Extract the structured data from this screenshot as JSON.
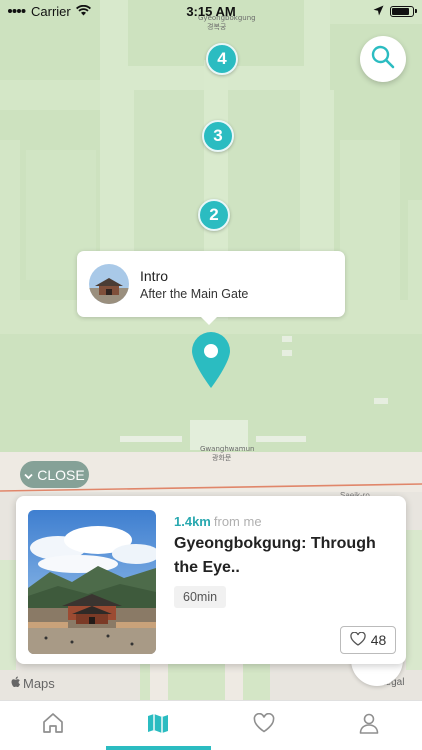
{
  "status_bar": {
    "carrier": "Carrier",
    "time": "3:15 AM",
    "battery_level_percent": 90
  },
  "map": {
    "place_label_en": "Gyeongbokgung",
    "place_label_kr": "경복궁",
    "gate_label_en": "Gwanghwamun",
    "gate_label_kr": "광화문",
    "road_label": "Saejk-ro",
    "maps_logo_text": "Maps",
    "legal_text": "Legal",
    "markers": [
      "4",
      "3",
      "2"
    ]
  },
  "callout": {
    "title": "Intro",
    "subtitle": "After the Main Gate"
  },
  "close_button": {
    "label": "CLOSE"
  },
  "tour_card": {
    "distance": "1.4km",
    "distance_suffix": "from me",
    "title": "Gyeongbokgung: Through the Eye..",
    "duration": "60min",
    "likes": "48"
  },
  "tabs": [
    {
      "name": "home",
      "icon": "home-icon"
    },
    {
      "name": "map",
      "icon": "map-icon",
      "active": true
    },
    {
      "name": "favorites",
      "icon": "heart-icon"
    },
    {
      "name": "profile",
      "icon": "user-icon"
    }
  ],
  "colors": {
    "accent": "#2bbcc1",
    "map_green": "#cde2bf",
    "close_chip": "#85a197"
  }
}
